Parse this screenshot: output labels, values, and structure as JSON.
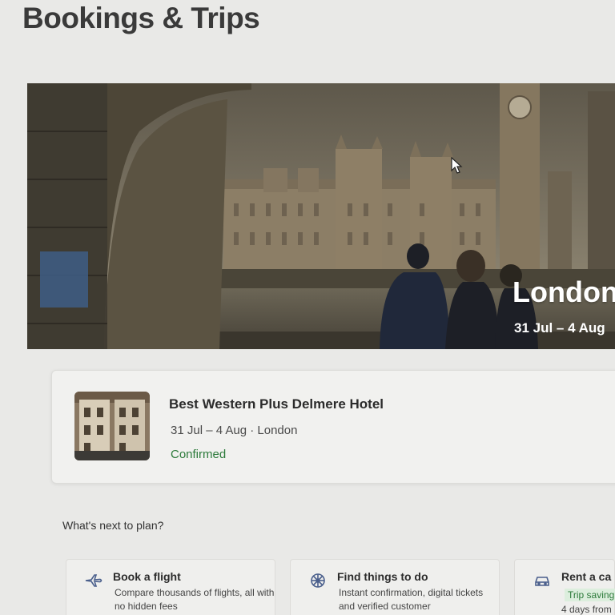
{
  "page": {
    "title": "Bookings & Trips"
  },
  "hero": {
    "city": "London",
    "dates": "31 Jul – 4 Aug"
  },
  "booking": {
    "hotel_name": "Best Western Plus Delmere Hotel",
    "meta": "31 Jul – 4 Aug · London",
    "status": "Confirmed"
  },
  "next": {
    "heading": "What's next to plan?",
    "cards": [
      {
        "icon": "plane-icon",
        "title": "Book a flight",
        "desc": "Compare thousands of flights, all with no hidden fees"
      },
      {
        "icon": "attractions-icon",
        "title": "Find things to do",
        "desc": "Instant confirmation, digital tickets and verified customer"
      },
      {
        "icon": "car-icon",
        "title": "Rent a ca",
        "badge": "Trip saving",
        "sub": "4 days from"
      }
    ]
  },
  "colors": {
    "confirmed": "#2c7a3a",
    "title": "#3a3a3a",
    "card_bg": "#f1f1ef"
  }
}
